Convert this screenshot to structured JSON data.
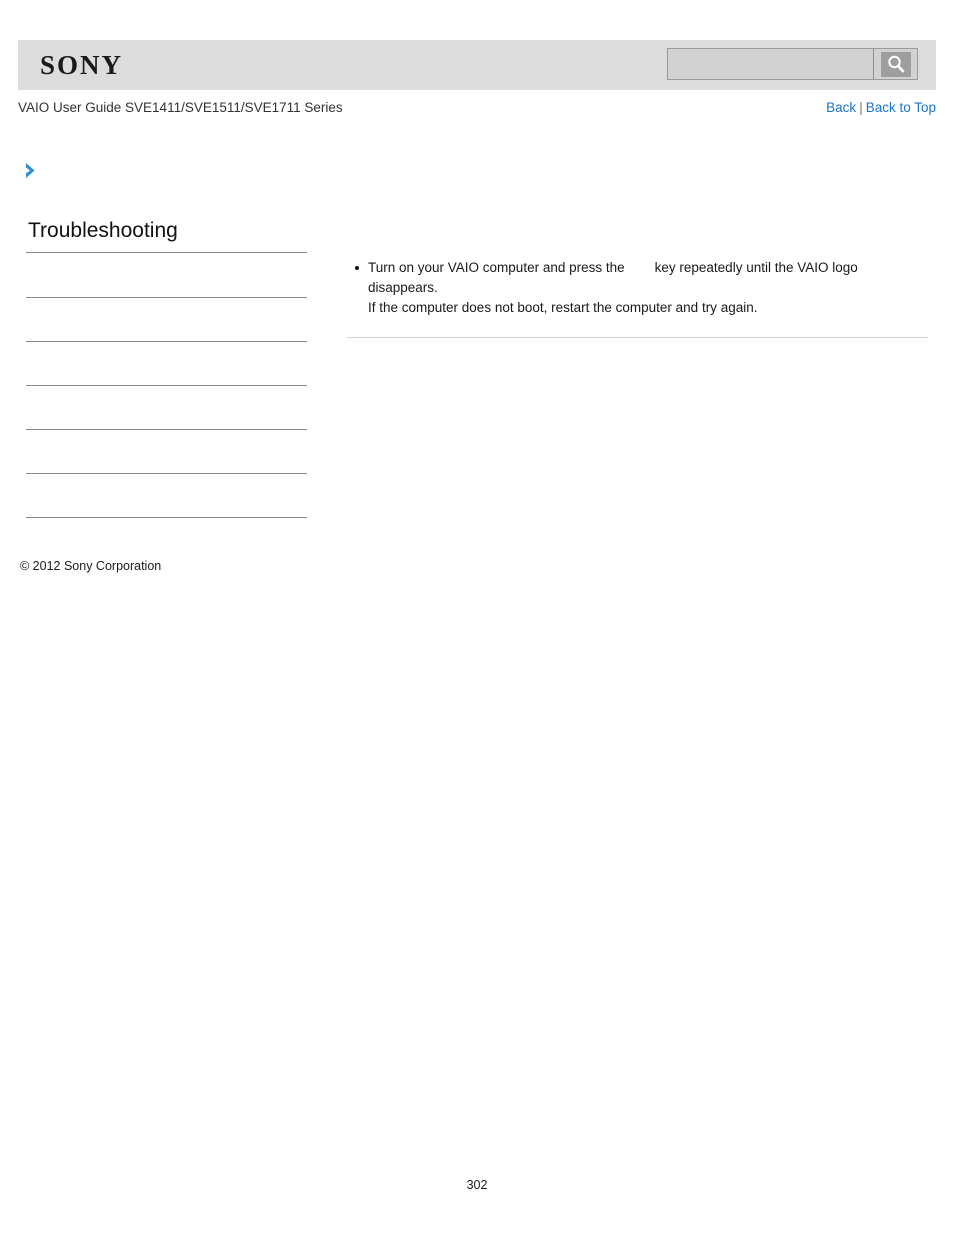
{
  "header": {
    "logo_text": "SONY",
    "guide_title": "VAIO User Guide SVE1411/SVE1511/SVE1711 Series",
    "back_link": "Back",
    "link_separator": "|",
    "back_to_top_link": "Back to Top",
    "search": {
      "value": "",
      "placeholder": "",
      "icon": "search-icon"
    }
  },
  "breadcrumb": {
    "icon": "chevron-right-icon",
    "label": ""
  },
  "sidebar": {
    "title": "Troubleshooting",
    "items": [
      {
        "label": ""
      },
      {
        "label": ""
      },
      {
        "label": ""
      },
      {
        "label": ""
      },
      {
        "label": ""
      },
      {
        "label": ""
      }
    ]
  },
  "content": {
    "bullets": [
      {
        "line1_before_key": "Turn on your VAIO computer and press the",
        "key_label": "",
        "line1_after_key": "key repeatedly until the VAIO logo",
        "line2": "disappears.",
        "line3": "If the computer does not boot, restart the computer and try again."
      }
    ]
  },
  "footer": {
    "copyright": "© 2012 Sony Corporation",
    "page_number": "302"
  },
  "colors": {
    "header_band": "#dcdcdc",
    "link_blue": "#1a73cc",
    "chevron_blue": "#2c8fd0",
    "rule_gray": "#8a8a8a",
    "content_rule_gray": "#d0d0d0"
  }
}
